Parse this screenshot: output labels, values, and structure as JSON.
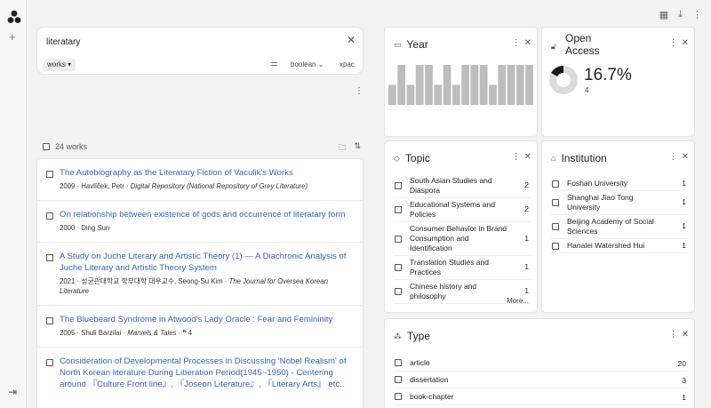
{
  "toolbar": {
    "layout_icon": "grid-icon",
    "download_icon": "download-icon",
    "menu_icon": "more-vert-icon"
  },
  "search": {
    "query": "literatary",
    "entity": "works",
    "mode": "boolean",
    "xpac": "xpac"
  },
  "results": {
    "count_label": "24 works",
    "items": [
      {
        "title": "The Autobiography as the Literatary Fiction of Vaculik's Works",
        "meta": "2009 · Havlíček, Petr · ",
        "source": "Digital Repository (National Repository of Grey Literature)",
        "extra": ""
      },
      {
        "title": "On relationship between existence of gods and occurrence of literatary form",
        "meta": "2000 · Ding Sun",
        "source": "",
        "extra": ""
      },
      {
        "title": "A Study on Juche Literary and Artistic Theory (1) — A Diachronic Analysis of Juche Literary and Artistic Theory System",
        "meta": "2021 · 성균관대학교 학부대학 대우교수, Seong-Su Kim · ",
        "source": "The Journal for Oversea Korean Literature",
        "extra": ""
      },
      {
        "title": "The Bluebeard Syndrome in Atwood's Lady Oracle : Fear and Femininity",
        "meta": "2005 · Shuli Barzilai · ",
        "source": "Marvels & Tales",
        "extra": " · ❞ 4"
      },
      {
        "title": "Consideration of Developmental Processes in Discussing 'Nobel Realism' of North Korean literature During Liberation Period(1945~1950) - Centering around 『Culture Front line』, 『Joseon Literature』, 『Literary Arts』 etc.",
        "meta": "",
        "source": "",
        "extra": ""
      }
    ]
  },
  "panels": {
    "year": {
      "title": "Year",
      "bars": [
        0.45,
        0.9,
        0.45,
        0.9,
        0.9,
        0.45,
        0.9,
        0.45,
        0.9,
        0.9,
        0.9,
        0.45,
        0.9,
        0.9,
        0.9,
        0.9
      ]
    },
    "open_access": {
      "title_line1": "Open",
      "title_line2": "Access",
      "percent": "16.7%",
      "count": "4",
      "fraction": 0.167
    },
    "topic": {
      "title": "Topic",
      "more": "More...",
      "items": [
        {
          "label": "South Asian Studies and Diaspora",
          "count": "2"
        },
        {
          "label": "Educational Systems and Policies",
          "count": "2"
        },
        {
          "label": "Consumer Behavior in Brand Consumption and Identification",
          "count": "1"
        },
        {
          "label": "Translation Studies and Practices",
          "count": "1"
        },
        {
          "label": "Chinese history and philosophy",
          "count": "1"
        }
      ]
    },
    "institution": {
      "title": "Institution",
      "items": [
        {
          "label": "Foshan University",
          "count": "1"
        },
        {
          "label": "Shanghai Jiao Tong University",
          "count": "1"
        },
        {
          "label": "Beijing Academy of Social Sciences",
          "count": "1"
        },
        {
          "label": "Hanalei Watershed Hui",
          "count": "1"
        }
      ]
    },
    "type": {
      "title": "Type",
      "items": [
        {
          "label": "article",
          "count": "20"
        },
        {
          "label": "dissertation",
          "count": "3"
        },
        {
          "label": "book-chapter",
          "count": "1"
        }
      ]
    }
  }
}
